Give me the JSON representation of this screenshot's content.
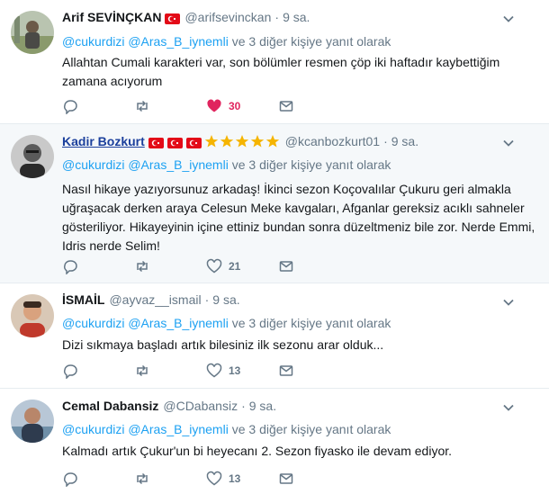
{
  "tweets": [
    {
      "name": "Arif SEVİNÇKAN",
      "handle": "@arifsevinckan",
      "time": "9 sa.",
      "reply_prefix": "",
      "mention1": "@cukurdizi",
      "mention2": "@Aras_B_iynemli",
      "reply_suffix": "ve 3 diğer kişiye yanıt olarak",
      "text": "Allahtan Cumali karakteri var, son bölümler resmen çöp iki haftadır kaybettiğim zamana acıyorum",
      "like_count": "30",
      "liked": true
    },
    {
      "name": "Kadir Bozkurt",
      "handle": "@kcanbozkurt01",
      "time": "9 sa.",
      "mention1": "@cukurdizi",
      "mention2": "@Aras_B_iynemli",
      "reply_suffix": "ve 3 diğer kişiye yanıt olarak",
      "text": "Nasıl hikaye yazıyorsunuz arkadaş! İkinci sezon Koçovalılar Çukuru geri almakla uğraşacak derken araya Celesun Meke kavgaları, Afganlar gereksiz acıklı sahneler gösteriliyor. Hikayeyinin içine ettiniz bundan sonra düzeltmeniz bile zor. Nerde Emmi, Idris nerde Selim!",
      "like_count": "21",
      "liked": false
    },
    {
      "name": "İSMAİL",
      "handle": "@ayvaz__ismail",
      "time": "9 sa.",
      "mention1": "@cukurdizi",
      "mention2": "@Aras_B_iynemli",
      "reply_suffix": "ve 3 diğer kişiye yanıt olarak",
      "text": "Dizi sıkmaya başladı artık bilesiniz ilk sezonu arar olduk...",
      "like_count": "13",
      "liked": false
    },
    {
      "name": "Cemal Dabansiz",
      "handle": "@CDabansiz",
      "time": "9 sa.",
      "mention1": "@cukurdizi",
      "mention2": "@Aras_B_iynemli",
      "reply_suffix": "ve 3 diğer kişiye yanıt olarak",
      "text": "Kalmadı artık Çukur'un bi heyecanı 2. Sezon fiyasko ile devam ediyor.",
      "like_count": "13",
      "liked": false
    }
  ],
  "colors": {
    "link_blue": "#1da1f2",
    "muted": "#657786",
    "like_red": "#e0245e",
    "star_gold": "#f5b400",
    "flag_red": "#e30a17"
  }
}
